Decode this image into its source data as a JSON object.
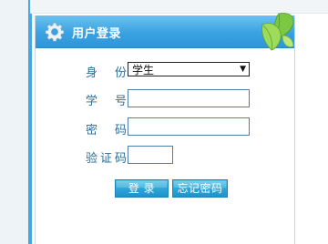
{
  "header": {
    "title": "用户登录",
    "icons": {
      "left": "gear-icon",
      "right": "leaf-icon"
    }
  },
  "form": {
    "identity": {
      "label": "身 份",
      "value": "学生"
    },
    "student_id": {
      "label": "学 号",
      "value": "",
      "placeholder": ""
    },
    "password": {
      "label": "密 码",
      "value": "",
      "placeholder": ""
    },
    "captcha": {
      "label": "验证码",
      "value": "",
      "placeholder": ""
    }
  },
  "buttons": {
    "login": "登 录",
    "forgot_password": "忘记密码"
  },
  "colors": {
    "header_blue": "#3aa2e2",
    "label_text": "#2f6d95",
    "button_blue": "#2fa6d8",
    "left_border": "#4aa6e0"
  }
}
